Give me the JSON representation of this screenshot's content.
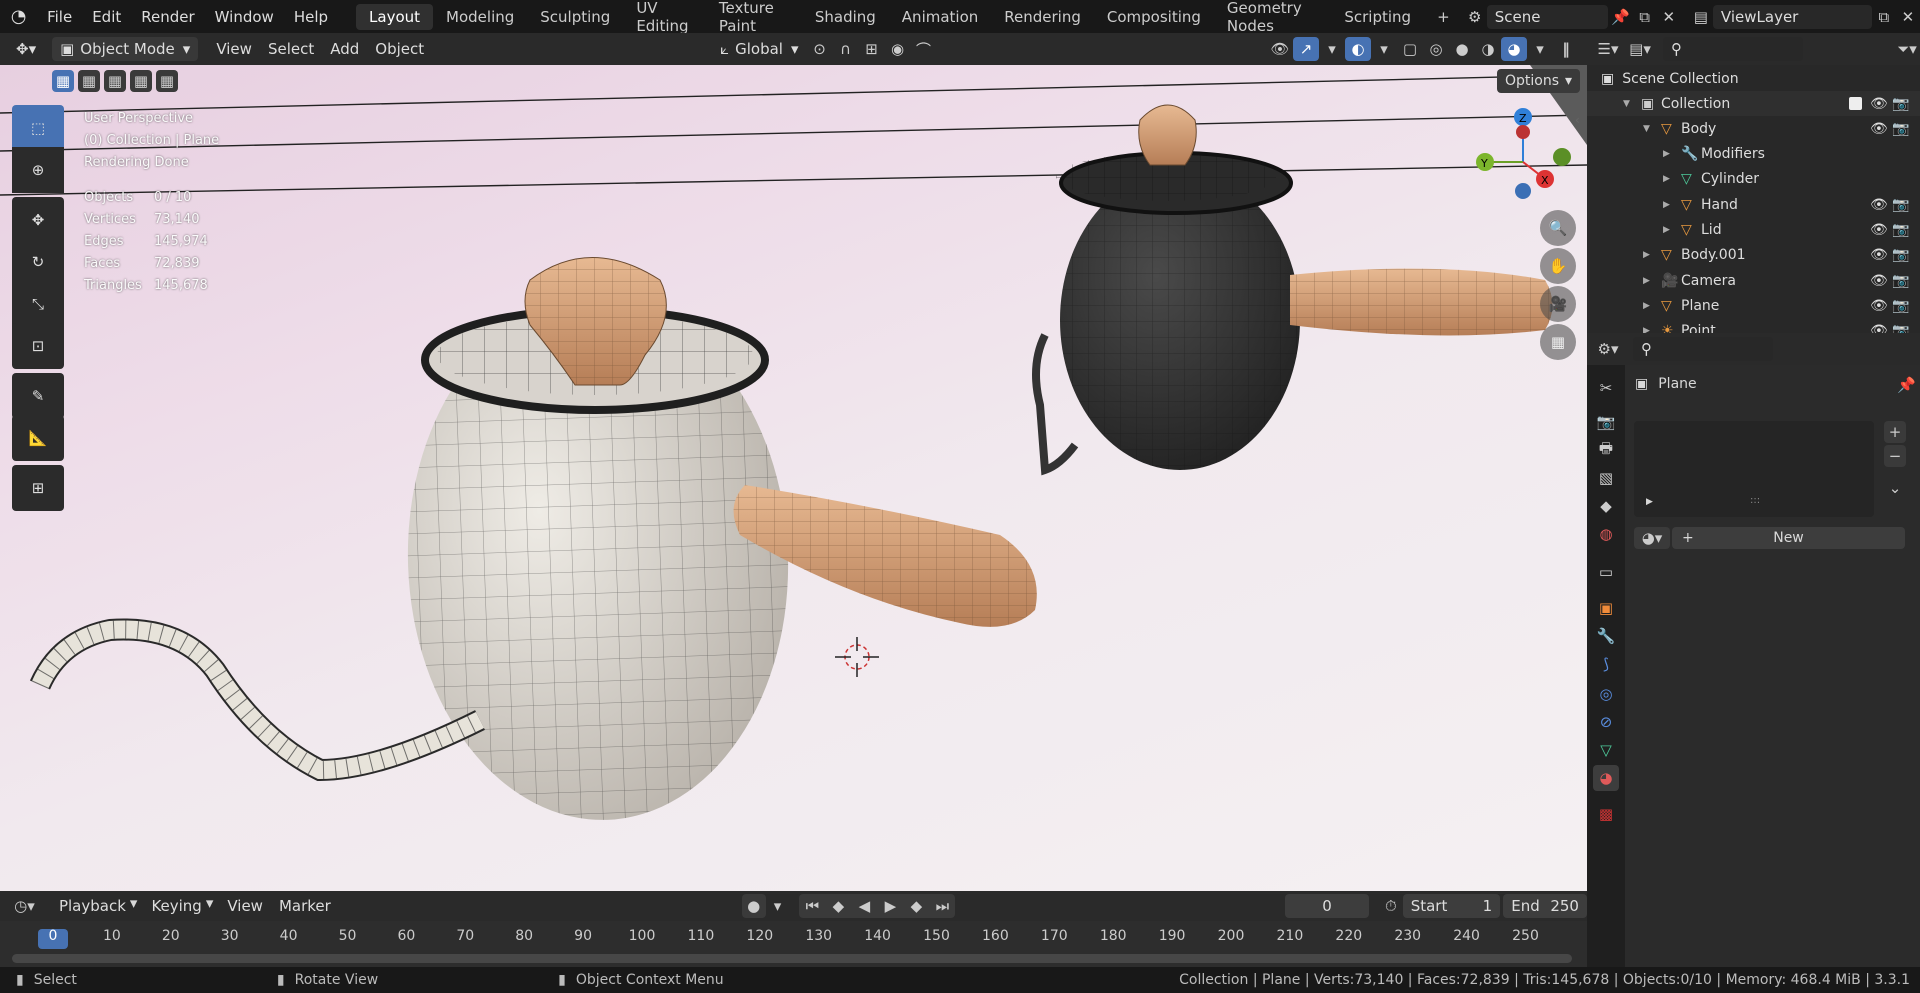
{
  "topbar": {
    "menus": [
      "File",
      "Edit",
      "Render",
      "Window",
      "Help"
    ],
    "workspaces": [
      "Layout",
      "Modeling",
      "Sculpting",
      "UV Editing",
      "Texture Paint",
      "Shading",
      "Animation",
      "Rendering",
      "Compositing",
      "Geometry Nodes",
      "Scripting"
    ],
    "active_workspace": "Layout",
    "add_tab": "+",
    "scene": "Scene",
    "view_layer": "ViewLayer"
  },
  "viewport_header": {
    "mode": "Object Mode",
    "menus": [
      "View",
      "Select",
      "Add",
      "Object"
    ],
    "orientation": "Global",
    "options": "Options"
  },
  "overlay": {
    "perspective": "User Perspective",
    "collection": "(0) Collection | Plane",
    "status": "Rendering Done",
    "stats": [
      {
        "label": "Objects",
        "value": "0 / 10"
      },
      {
        "label": "Vertices",
        "value": "73,140"
      },
      {
        "label": "Edges",
        "value": "145,974"
      },
      {
        "label": "Faces",
        "value": "72,839"
      },
      {
        "label": "Triangles",
        "value": "145,678"
      }
    ]
  },
  "gizmo": {
    "x": "X",
    "y": "Y",
    "z": "Z"
  },
  "outliner": {
    "root": "Scene Collection",
    "items": [
      {
        "label": "Collection",
        "depth": 1,
        "icon": "collection-icon",
        "color": "#cccccc"
      },
      {
        "label": "Body",
        "depth": 2,
        "icon": "mesh-object-icon",
        "color": "#e8993f"
      },
      {
        "label": "Modifiers",
        "depth": 3,
        "icon": "wrench-icon",
        "color": "#6b9df0"
      },
      {
        "label": "Cylinder",
        "depth": 3,
        "icon": "mesh-data-icon",
        "color": "#4ecb9b"
      },
      {
        "label": "Hand",
        "depth": 3,
        "icon": "mesh-object-icon",
        "color": "#e8993f"
      },
      {
        "label": "Lid",
        "depth": 3,
        "icon": "mesh-object-icon",
        "color": "#e8993f"
      },
      {
        "label": "Body.001",
        "depth": 2,
        "icon": "mesh-object-icon",
        "color": "#e8993f"
      },
      {
        "label": "Camera",
        "depth": 2,
        "icon": "camera-icon",
        "color": "#e8993f"
      },
      {
        "label": "Plane",
        "depth": 2,
        "icon": "mesh-object-icon",
        "color": "#e8993f"
      },
      {
        "label": "Point",
        "depth": 2,
        "icon": "light-icon",
        "color": "#e8993f"
      }
    ]
  },
  "properties": {
    "object_name": "Plane",
    "new_button": "New",
    "slot_handle": ":::"
  },
  "timeline": {
    "menus": [
      "Playback",
      "Keying",
      "View",
      "Marker"
    ],
    "current_frame": "0",
    "start_label": "Start",
    "start_value": "1",
    "end_label": "End",
    "end_value": "250",
    "ticks": [
      "0",
      "10",
      "20",
      "30",
      "40",
      "50",
      "60",
      "70",
      "80",
      "90",
      "100",
      "110",
      "120",
      "130",
      "140",
      "150",
      "160",
      "170",
      "180",
      "190",
      "200",
      "210",
      "220",
      "230",
      "240",
      "250"
    ]
  },
  "statusbar": {
    "select": "Select",
    "rotate": "Rotate View",
    "context": "Object Context Menu",
    "info": "Collection | Plane | Verts:73,140 | Faces:72,839 | Tris:145,678 | Objects:0/10 | Memory: 468.4 MiB | 3.3.1"
  }
}
